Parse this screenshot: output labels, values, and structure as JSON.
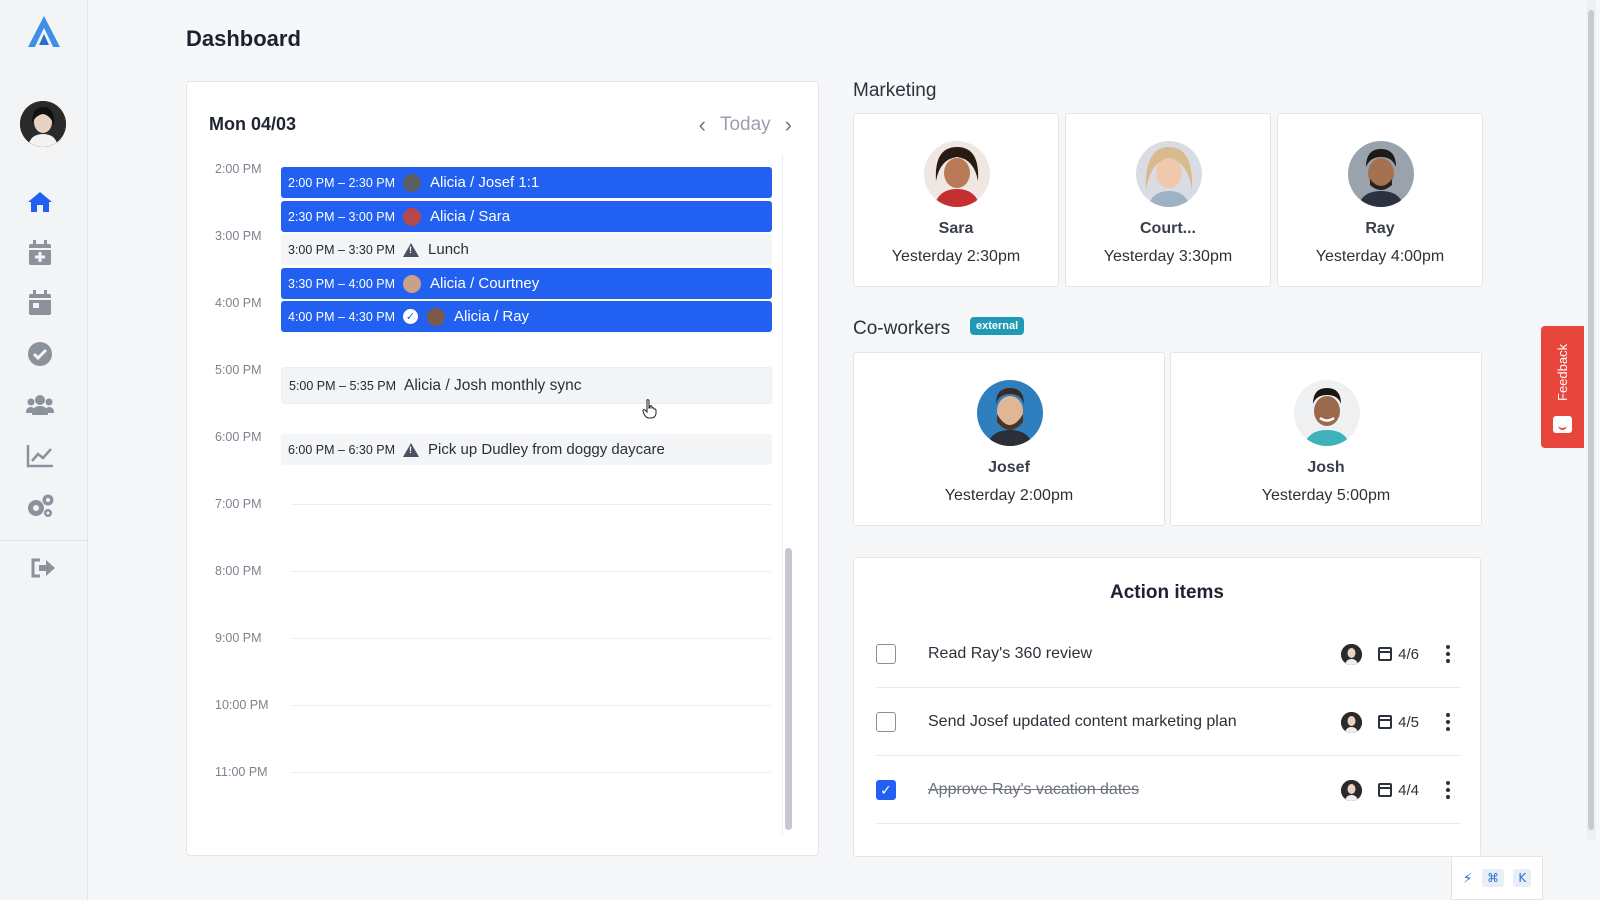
{
  "page": {
    "title": "Dashboard"
  },
  "colors": {
    "accent": "#2160f0",
    "feedback": "#e8453c",
    "badge": "#1f9ab4"
  },
  "sidebar": {
    "items": [
      {
        "icon": "home-icon",
        "active": true
      },
      {
        "icon": "calendar-plus-icon"
      },
      {
        "icon": "calendar-icon"
      },
      {
        "icon": "check-circle-icon"
      },
      {
        "icon": "users-icon"
      },
      {
        "icon": "chart-icon"
      },
      {
        "icon": "settings-icon"
      },
      {
        "icon": "logout-icon"
      }
    ]
  },
  "calendar": {
    "date": "Mon 04/03",
    "today_label": "Today",
    "hours": [
      "2:00 PM",
      "3:00 PM",
      "4:00 PM",
      "5:00 PM",
      "6:00 PM",
      "7:00 PM",
      "8:00 PM",
      "9:00 PM",
      "10:00 PM",
      "11:00 PM"
    ],
    "events": [
      {
        "time": "2:00 PM – 2:30 PM",
        "title": "Alicia / Josef 1:1",
        "style": "blue",
        "marker": "avatar"
      },
      {
        "time": "2:30 PM – 3:00 PM",
        "title": "Alicia / Sara",
        "style": "blue",
        "marker": "avatar"
      },
      {
        "time": "3:00 PM – 3:30 PM",
        "title": "Lunch",
        "style": "gray",
        "marker": "warning"
      },
      {
        "time": "3:30 PM – 4:00 PM",
        "title": "Alicia / Courtney",
        "style": "blue",
        "marker": "avatar"
      },
      {
        "time": "4:00 PM – 4:30 PM",
        "title": "Alicia / Ray",
        "style": "blue",
        "marker": "check-avatar"
      },
      {
        "time": "5:00 PM – 5:35 PM",
        "title": "Alicia / Josh monthly sync",
        "style": "gray",
        "marker": "none"
      },
      {
        "time": "6:00 PM – 6:30 PM",
        "title": "Pick up Dudley from doggy daycare",
        "style": "gray",
        "marker": "warning"
      }
    ]
  },
  "marketing": {
    "heading": "Marketing",
    "people": [
      {
        "name": "Sara",
        "last": "Yesterday 2:30pm"
      },
      {
        "name": "Court...",
        "last": "Yesterday 3:30pm"
      },
      {
        "name": "Ray",
        "last": "Yesterday 4:00pm"
      }
    ]
  },
  "coworkers": {
    "heading": "Co-workers",
    "badge": "external",
    "people": [
      {
        "name": "Josef",
        "last": "Yesterday 2:00pm"
      },
      {
        "name": "Josh",
        "last": "Yesterday 5:00pm"
      }
    ]
  },
  "actions": {
    "title": "Action items",
    "items": [
      {
        "text": "Read Ray's 360 review",
        "due": "4/6",
        "done": false
      },
      {
        "text": "Send Josef updated content marketing plan",
        "due": "4/5",
        "done": false
      },
      {
        "text": "Approve Ray's vacation dates",
        "due": "4/4",
        "done": true
      }
    ]
  },
  "feedback": {
    "label": "Feedback"
  },
  "shortcut": {
    "key1": "⌘",
    "key2": "K"
  }
}
